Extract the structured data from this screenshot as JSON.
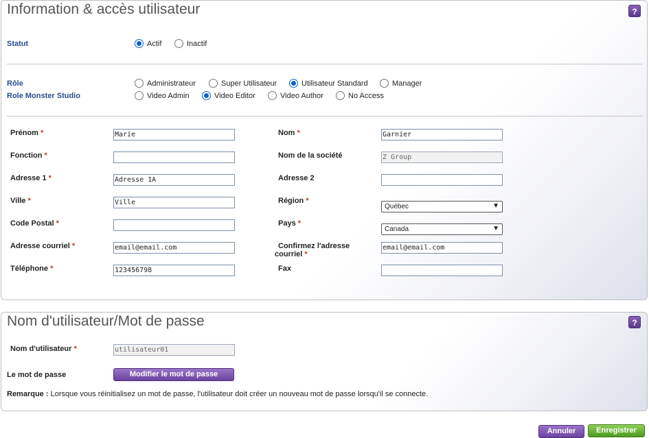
{
  "info": {
    "title": "Information & accès utilisateur",
    "help": "?",
    "statut": {
      "label": "Statut",
      "options": [
        "Actif",
        "Inactif"
      ],
      "selected": "Actif"
    },
    "role": {
      "label": "Rôle",
      "options": [
        "Administrateur",
        "Super Utilisateur",
        "Utilisateur Standard",
        "Manager"
      ],
      "selected": "Utilisateur Standard"
    },
    "role_monster": {
      "label": "Role Monster Studio",
      "options": [
        "Video Admin",
        "Video Editor",
        "Video Author",
        "No Access"
      ],
      "selected": "Video Editor"
    },
    "fields": {
      "prenom": {
        "label": "Prénom",
        "value": "Marie"
      },
      "nom": {
        "label": "Nom",
        "value": "Garnier"
      },
      "fonction": {
        "label": "Fonction",
        "value": ""
      },
      "societe": {
        "label": "Nom de la société",
        "value": "Z Group"
      },
      "adresse1": {
        "label": "Adresse 1",
        "value": "Adresse 1A"
      },
      "adresse2": {
        "label": "Adresse 2",
        "value": ""
      },
      "ville": {
        "label": "Ville",
        "value": "Ville"
      },
      "region": {
        "label": "Région",
        "value": "Québec"
      },
      "code_postal": {
        "label": "Code Postal",
        "value": ""
      },
      "pays": {
        "label": "Pays",
        "value": "Canada"
      },
      "courriel": {
        "label": "Adresse courriel",
        "value": "email@email.com"
      },
      "confirm_courriel": {
        "label_line1": "Confirmez l'adresse",
        "label_line2": "courriel",
        "value": "email@email.com"
      },
      "telephone": {
        "label": "Téléphone",
        "value": "123456798"
      },
      "fax": {
        "label": "Fax",
        "value": ""
      }
    },
    "required_mark": "*"
  },
  "user": {
    "title": "Nom d'utilisateur/Mot de passe",
    "help": "?",
    "username": {
      "label": "Nom d'utilisateur",
      "value": "utilisateur01"
    },
    "password_label": "Le mot de passe",
    "change_password_button": "Modifier le mot de passe",
    "remark_prefix": "Remarque :",
    "remark_text": "Lorsque vous réinitialisez un mot de passe, l'utilisateur doit créer un nouveau mot de passe lorsqu'il se connecte."
  },
  "actions": {
    "cancel": "Annuler",
    "save": "Enregistrer"
  },
  "colors": {
    "accent_purple": "#6a449e",
    "accent_green": "#4f9a22",
    "radio_blue": "#0a62d4",
    "section_label_blue": "#2a4d8f"
  }
}
